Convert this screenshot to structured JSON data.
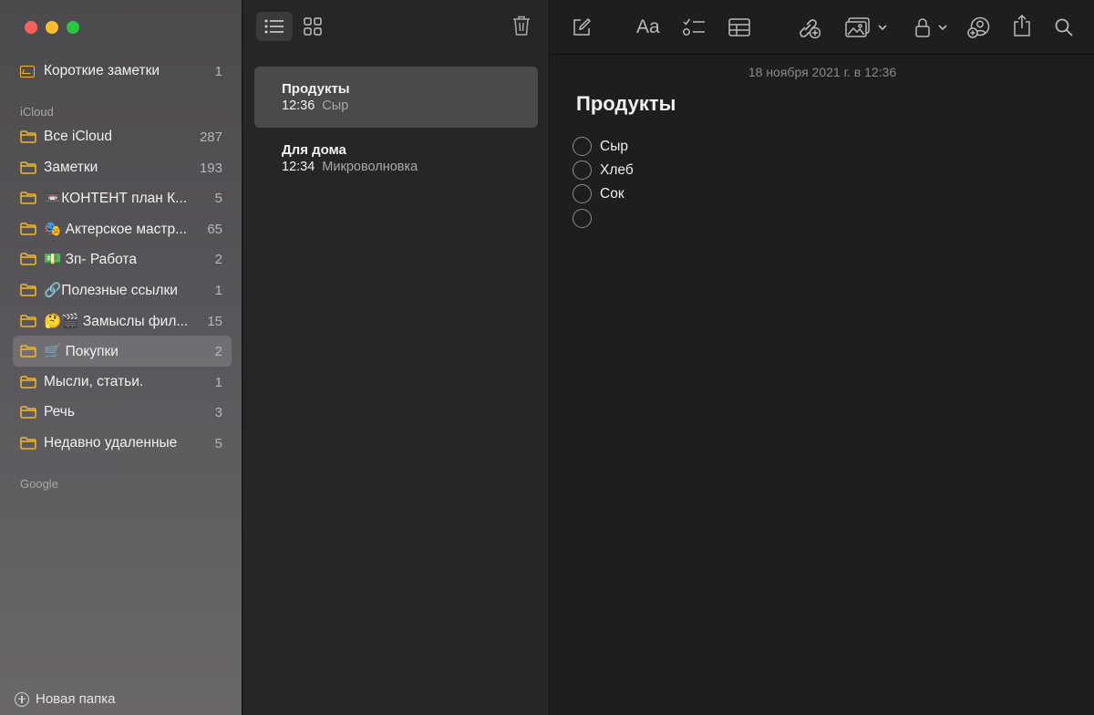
{
  "sidebar": {
    "quick_notes": {
      "label": "Короткие заметки",
      "count": "1"
    },
    "sections": {
      "icloud": "iCloud",
      "google": "Google"
    },
    "folders": [
      {
        "label": "Все iCloud",
        "count": "287"
      },
      {
        "label": "Заметки",
        "count": "193"
      },
      {
        "label": "📼КОНТЕНТ план К...",
        "count": "5"
      },
      {
        "label": "🎭 Актерское мастр...",
        "count": "65"
      },
      {
        "label": "💵 Зп- Работа",
        "count": "2"
      },
      {
        "label": "🔗Полезные ссылки",
        "count": "1"
      },
      {
        "label": "🤔🎬 Замыслы фил...",
        "count": "15"
      },
      {
        "label": "🛒 Покупки",
        "count": "2"
      },
      {
        "label": "Мысли, статьи.",
        "count": "1"
      },
      {
        "label": "Речь",
        "count": "3"
      },
      {
        "label": "Недавно удаленные",
        "count": "5"
      }
    ],
    "selected_folder": "🛒 Покупки",
    "new_folder_label": "Новая папка"
  },
  "note_list": {
    "notes": [
      {
        "title": "Продукты",
        "time": "12:36",
        "preview": "Сыр"
      },
      {
        "title": "Для дома",
        "time": "12:34",
        "preview": "Микроволновка"
      }
    ]
  },
  "editor": {
    "date": "18 ноября 2021 г. в 12:36",
    "title": "Продукты",
    "format_label": "Aa",
    "checklist": [
      "Сыр",
      "Хлеб",
      "Сок",
      ""
    ]
  },
  "colors": {
    "accent_folder": "#f0b92b",
    "selection": "#4a4a4a"
  }
}
